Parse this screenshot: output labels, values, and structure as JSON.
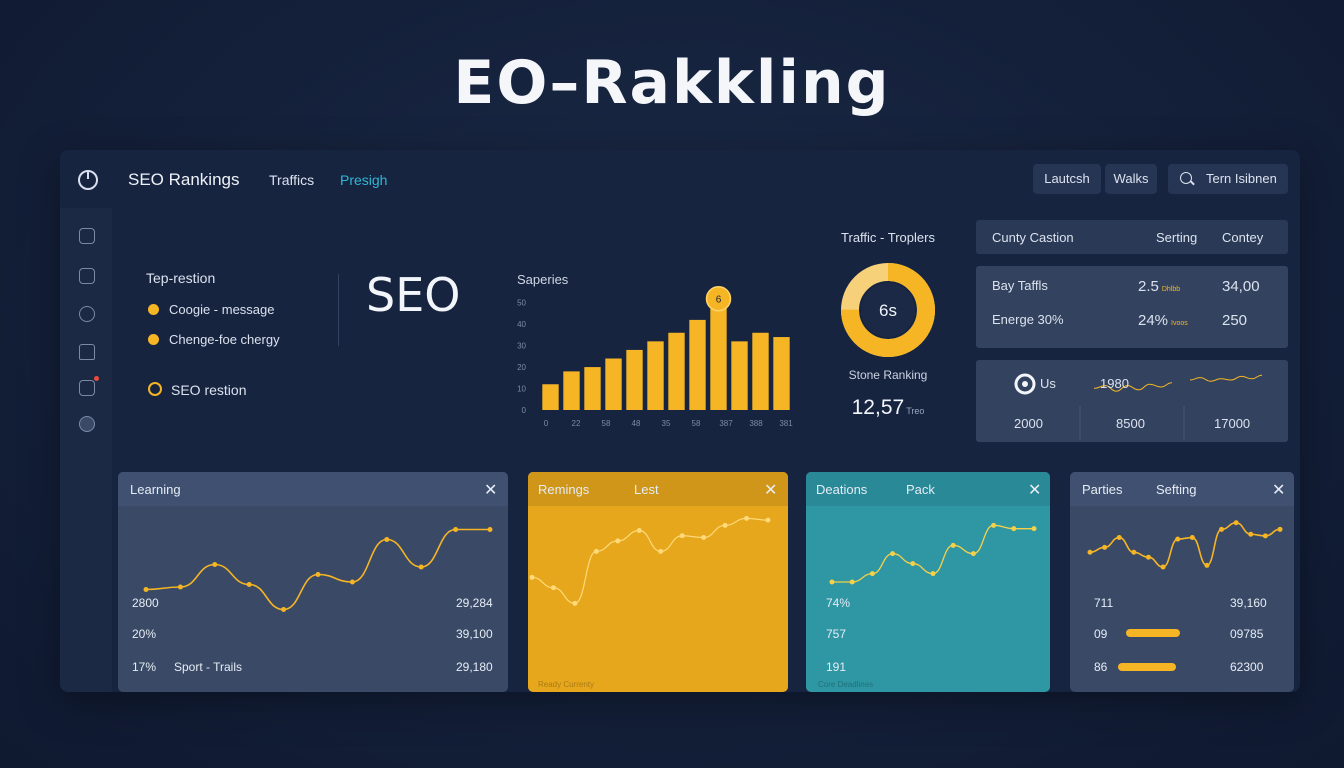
{
  "hero_title": "EO–Rakkling",
  "topbar": {
    "app_name": "SEO Rankings",
    "tabs": [
      "Traffics",
      "Presigh"
    ],
    "buttons": [
      "Lautcsh",
      "Walks"
    ],
    "search_label": "Tern Isibnen"
  },
  "sidebar": {
    "icons": [
      "list-icon",
      "chart-icon",
      "info-icon",
      "lock-icon",
      "megaphone-icon",
      "chat-icon"
    ],
    "notification_color": "#e74c3c"
  },
  "legend": {
    "title": "Tep-restion",
    "items": [
      "Coogie - message",
      "Chenge-foe chergy"
    ],
    "footer": "SEO restion",
    "dot_color": "#f5b524"
  },
  "seo_big": "SEO",
  "bar_chart": {
    "title": "Saperies",
    "accent": "#f5b524",
    "highlight_label": "6"
  },
  "donut": {
    "title": "Traffic - Troplers",
    "center": "6s",
    "percent": 75,
    "label": "Stone Ranking",
    "value": "12,57",
    "value_suffix": "Treo"
  },
  "stats": {
    "headers": [
      "Cunty Castion",
      "Serting",
      "Contey"
    ],
    "rows": [
      {
        "label": "Bay Taffls",
        "value": "2.5",
        "unit": "Dhlbb",
        "total": "34,00"
      },
      {
        "label": "Energe 30%",
        "value": "24%",
        "unit": "Ivoos",
        "total": "250"
      }
    ],
    "spark": {
      "label": "Us",
      "value": "1980",
      "cols": [
        "2000",
        "8500",
        "17000"
      ]
    }
  },
  "cards": [
    {
      "title": "Learning",
      "rows": [
        [
          "2800",
          "29,284"
        ],
        [
          "20%",
          "39,100"
        ],
        [
          "17%",
          "29,180"
        ]
      ],
      "row3_label": "Sport - Trails"
    },
    {
      "titles": [
        "Remings",
        "Lest"
      ],
      "footnote": "Ready Currenty"
    },
    {
      "titles": [
        "Deations",
        "Pack"
      ],
      "values": [
        "74%",
        "757",
        "191"
      ],
      "footnote": "Core Deadlines"
    },
    {
      "titles": [
        "Parties",
        "Sefting"
      ],
      "rows": [
        [
          "711",
          "39,160"
        ],
        [
          "09",
          "09785"
        ],
        [
          "86",
          "62300"
        ]
      ]
    }
  ],
  "chart_data": [
    {
      "type": "bar",
      "title": "Saperies",
      "categories": [
        "0",
        "22",
        "58",
        "48",
        "35",
        "58",
        "387",
        "388",
        "381"
      ],
      "values": [
        12,
        18,
        20,
        24,
        28,
        32,
        36,
        42,
        50,
        32,
        36,
        34
      ],
      "y_ticks": [
        "0",
        "10",
        "20",
        "30",
        "40",
        "50"
      ],
      "ylim": [
        0,
        55
      ],
      "highlight_index": 8
    },
    {
      "type": "line",
      "name": "Learning",
      "values": [
        18,
        20,
        38,
        22,
        2,
        30,
        24,
        58,
        36,
        66,
        66
      ],
      "ylim": [
        0,
        80
      ]
    },
    {
      "type": "line",
      "name": "Remings",
      "values": [
        30,
        18,
        0,
        60,
        72,
        84,
        60,
        78,
        76,
        90,
        98,
        96
      ],
      "ylim": [
        -10,
        110
      ]
    },
    {
      "type": "line",
      "name": "Deations",
      "values": [
        36,
        36,
        46,
        70,
        58,
        46,
        80,
        70,
        104,
        100,
        100
      ],
      "ylim": [
        0,
        120
      ]
    },
    {
      "type": "line",
      "name": "Parties",
      "values": [
        46,
        52,
        64,
        46,
        40,
        28,
        62,
        64,
        30,
        74,
        82,
        68,
        66,
        74
      ],
      "ylim": [
        0,
        100
      ]
    },
    {
      "type": "line",
      "name": "Us-spark-1",
      "values": [
        4,
        6,
        2,
        6,
        3,
        7,
        5,
        8
      ],
      "ylim": [
        0,
        10
      ]
    },
    {
      "type": "line",
      "name": "Us-spark-2",
      "values": [
        5,
        7,
        4,
        6,
        5,
        8,
        6,
        9
      ],
      "ylim": [
        0,
        10
      ]
    }
  ]
}
